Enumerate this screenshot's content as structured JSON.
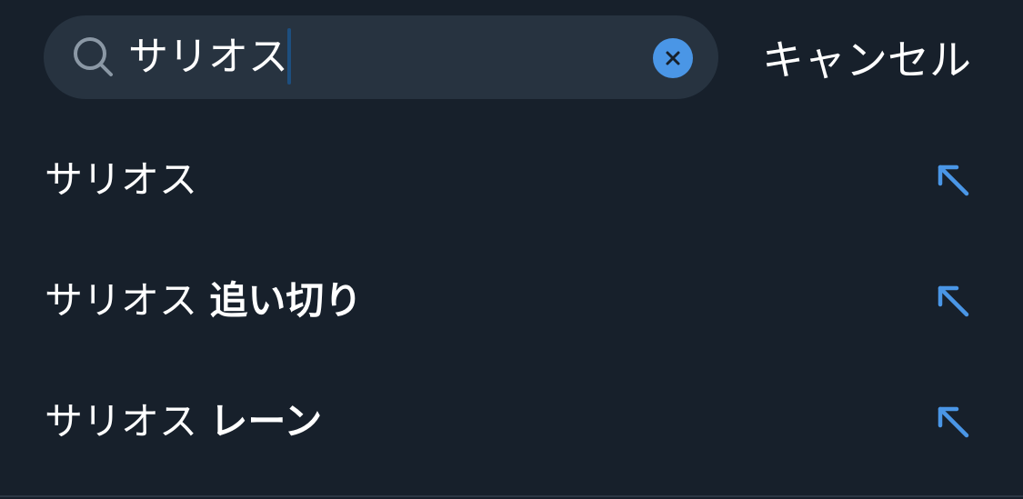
{
  "search": {
    "query": "サリオス",
    "cancel_label": "キャンセル"
  },
  "suggestions": [
    {
      "prefix": "サリオス",
      "suffix": ""
    },
    {
      "prefix": "サリオス",
      "suffix": "追い切り"
    },
    {
      "prefix": "サリオス",
      "suffix": "レーン"
    }
  ],
  "icons": {
    "search": "search-icon",
    "clear": "close-icon",
    "suggestion": "arrow-up-left-icon"
  },
  "colors": {
    "background": "#17202b",
    "search_box": "#273340",
    "accent": "#4a96e6",
    "text": "#ffffff"
  }
}
